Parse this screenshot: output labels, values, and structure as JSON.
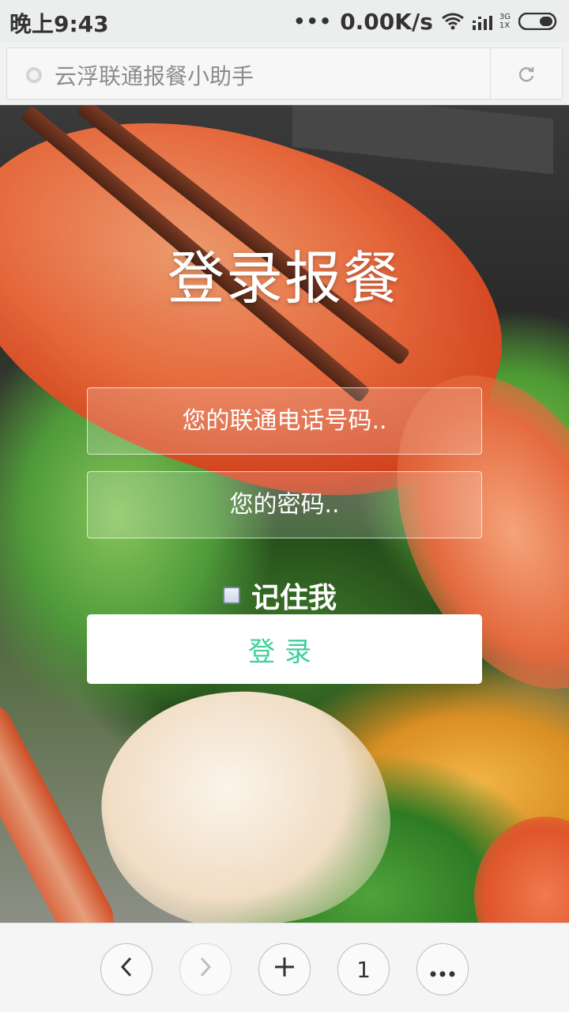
{
  "status_bar": {
    "time": "晚上9:43",
    "dots": "•••",
    "speed": "0.00K/s",
    "net_top": "3G",
    "net_bottom": "1X"
  },
  "address_bar": {
    "title": "云浮联通报餐小助手"
  },
  "login": {
    "title": "登录报餐",
    "phone_placeholder": "您的联通电话号码..",
    "password_placeholder": "您的密码..",
    "remember_label": "记住我",
    "login_button": "登录"
  },
  "toolbar": {
    "tab_count": "1"
  },
  "colors": {
    "accent": "#3fcf9a",
    "status_bar_bg": "#eceeee"
  }
}
